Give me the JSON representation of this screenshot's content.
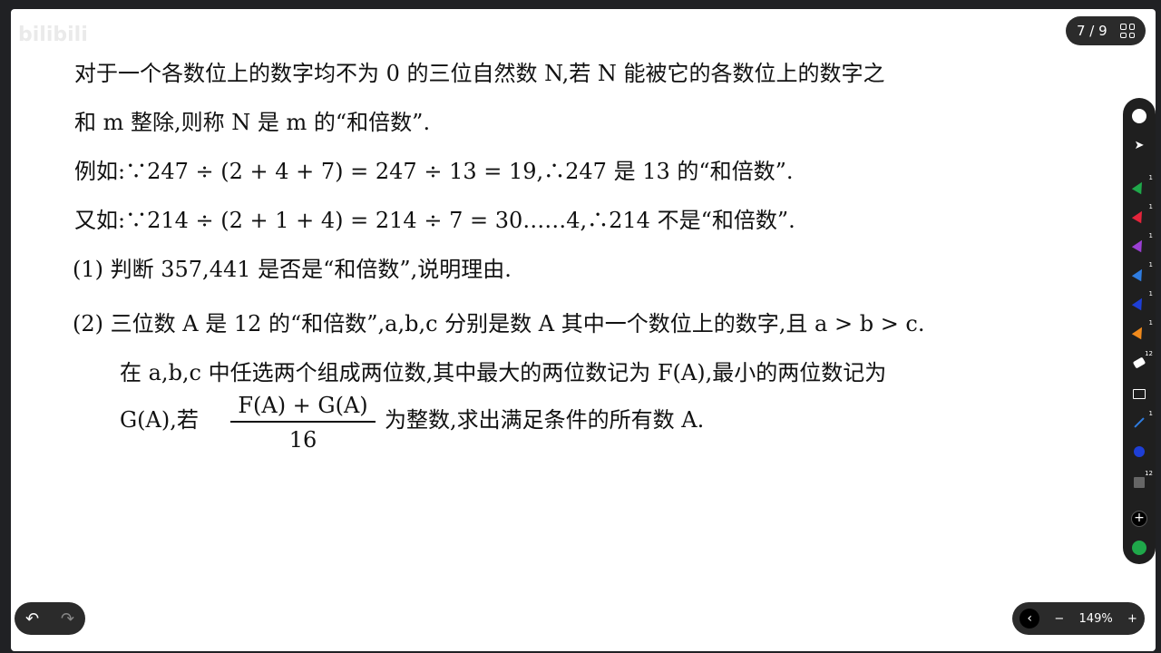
{
  "watermark": "bilibili",
  "problem": {
    "line1": "对于一个各数位上的数字均不为 0 的三位自然数 N,若 N 能被它的各数位上的数字之",
    "line2": "和 m 整除,则称 N 是 m 的“和倍数”.",
    "line3": "例如:∵247 ÷ (2 + 4 + 7) = 247 ÷ 13 = 19,∴247 是 13 的“和倍数”.",
    "line4": "又如:∵214 ÷ (2 + 1 + 4) = 214 ÷ 7 = 30……4,∴214 不是“和倍数”.",
    "q1": "(1) 判断 357,441 是否是“和倍数”,说明理由.",
    "q2_line1": "(2) 三位数 A 是 12 的“和倍数”,a,b,c 分别是数 A 其中一个数位上的数字,且 a > b > c.",
    "q2_line2": "在 a,b,c 中任选两个组成两位数,其中最大的两位数记为 F(A),最小的两位数记为",
    "q2_line3_prefix": "G(A),若",
    "fraction_num": "F(A) + G(A)",
    "fraction_den": "16",
    "q2_line3_suffix": "为整数,求出满足条件的所有数 A."
  },
  "page_indicator": "7 / 9",
  "zoom": "149%",
  "toolbar": {
    "badges": [
      "1",
      "1",
      "1",
      "1",
      "1",
      "1",
      "12",
      "1",
      "12"
    ]
  },
  "colors": {
    "green": "#1fa84a",
    "red": "#e5243b",
    "purple": "#9b3fd4",
    "blue": "#2f7de1",
    "darkblue": "#1e3fd6",
    "orange": "#f08a1c"
  }
}
